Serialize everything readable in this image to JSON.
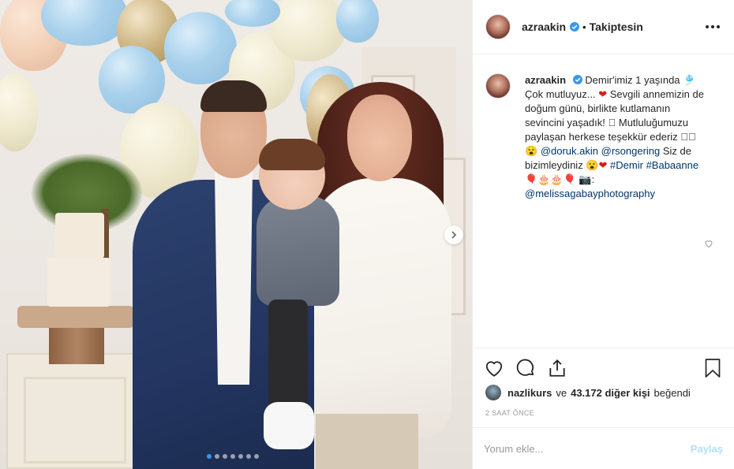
{
  "header": {
    "username": "azraakin",
    "separator": "•",
    "follow_status": "Takiptesin"
  },
  "caption": {
    "username": "azraakin",
    "line1": "Demir'imiz 1 yaşında 🎐",
    "line2a": "Çok mutluyuz... ",
    "heart": "❤",
    "line2b": " Sevgili annemizin de doğum günü, birlikte kutlamanın sevincini yaşadık! ",
    "box1": "⃞",
    "line3": " Mutluluğumuzu paylaşan herkese teşekkür ederiz ⃞⃞",
    "emoji1": "😮 ",
    "mention1": "@doruk.akin",
    "mention2": "@rsongering",
    "line4": " Siz de bizimleydiniz 😮",
    "heart2": "❤",
    "hashtag1": "#Demir",
    "hashtag2": "#Babaanne",
    "emoji_row": "🎈🎂🎂🎈 📷: ",
    "mention3": "@melissagabayphotography"
  },
  "likes": {
    "first_user": "nazlikurs",
    "connector": "ve",
    "count": "43.172 diğer kişi",
    "suffix": "beğendi"
  },
  "timestamp": "2 SAAT ÖNCE",
  "comment": {
    "placeholder": "Yorum ekle...",
    "post_label": "Paylaş"
  },
  "carousel": {
    "total": 7,
    "active_index": 0
  },
  "colors": {
    "accent_blue": "#3897f0",
    "link": "#003569",
    "post_disabled": "#b2dffc",
    "verified": "#3897f0"
  },
  "icons": [
    "verified-badge-icon",
    "more-options-icon",
    "heart-icon",
    "comment-icon",
    "share-icon",
    "bookmark-icon",
    "chevron-right-icon"
  ]
}
